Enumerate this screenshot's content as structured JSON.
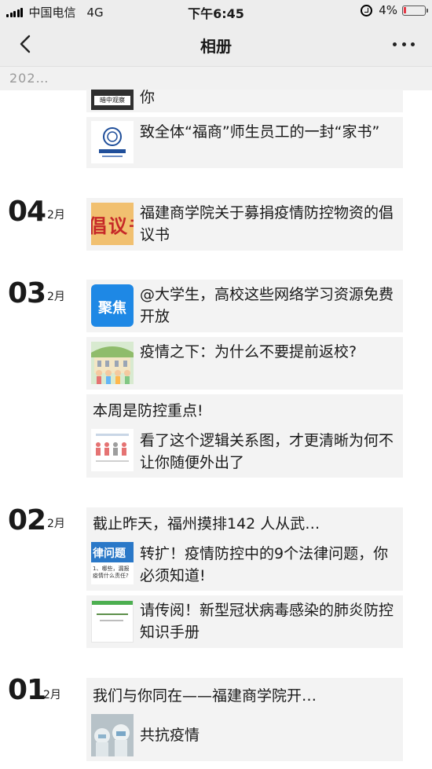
{
  "status_bar": {
    "carrier": "中国电信",
    "network": "4G",
    "time": "下午6:45",
    "battery": "4%",
    "battery_level": 0.04
  },
  "nav": {
    "title": "相册",
    "back_icon": "chevron-left-icon",
    "more_icon": "more-dots-icon"
  },
  "year_label": "202…",
  "thumbs": {
    "t0_caption": "暗中观察",
    "t2_text": "倡议书",
    "t3_text": "聚焦",
    "t5_title": "律问题",
    "t5_sub": "1、哪些，漏报疫情什么责任?"
  },
  "groups": [
    {
      "day": "",
      "month": "",
      "posts": [
        {
          "text": "你"
        },
        {
          "text": "致全体“福商”师生员工的一封“家书”"
        }
      ]
    },
    {
      "day": "04",
      "month": "2月",
      "posts": [
        {
          "text": "福建商学院关于募捐疫情防控物资的倡议书"
        }
      ]
    },
    {
      "day": "03",
      "month": "2月",
      "posts": [
        {
          "text": "@大学生，高校这些网络学习资源免费开放"
        },
        {
          "text": "疫情之下：为什么不要提前返校?"
        },
        {
          "caption": "本周是防控重点!",
          "text": "看了这个逻辑关系图，才更清晰为何不让你随便外出了"
        }
      ]
    },
    {
      "day": "02",
      "month": "2月",
      "posts": [
        {
          "caption": "截止昨天，福州摸排142 人从武…",
          "text": "转扩！疫情防控中的9个法律问题，你必须知道!"
        },
        {
          "text": "请传阅！新型冠状病毒感染的肺炎防控知识手册"
        }
      ]
    },
    {
      "day": "01",
      "month": "2月",
      "posts": [
        {
          "caption": "我们与你同在——福建商学院开…",
          "text": "共抗疫情"
        }
      ]
    }
  ],
  "colors": {
    "bar_bg": "#ededed",
    "card_bg": "#f3f3f3",
    "battery_low": "#e63946",
    "app_blue": "#1e88e5"
  }
}
